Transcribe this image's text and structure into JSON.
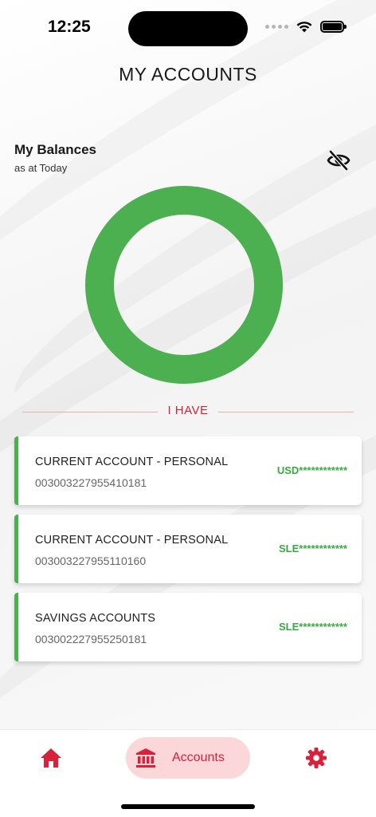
{
  "status": {
    "time": "12:25"
  },
  "header": {
    "title": "MY ACCOUNTS"
  },
  "balances": {
    "title": "My Balances",
    "subtitle": "as at Today",
    "visibility_icon": "eye-off-icon"
  },
  "chart": {
    "segment_color": "#4caf50"
  },
  "section": {
    "label": "I HAVE"
  },
  "accounts": [
    {
      "name": "CURRENT ACCOUNT - PERSONAL",
      "number": "003003227955410181",
      "balance": "USD************"
    },
    {
      "name": "CURRENT ACCOUNT - PERSONAL",
      "number": "003003227955110160",
      "balance": "SLE************"
    },
    {
      "name": "SAVINGS ACCOUNTS",
      "number": "003002227955250181",
      "balance": "SLE************"
    }
  ],
  "nav": {
    "home_icon": "home-icon",
    "accounts_icon": "bank-icon",
    "accounts_label": "Accounts",
    "settings_icon": "gear-icon"
  },
  "colors": {
    "brand_red": "#d9213a",
    "accent_green": "#4caf50",
    "active_pill": "#fbd7da"
  }
}
